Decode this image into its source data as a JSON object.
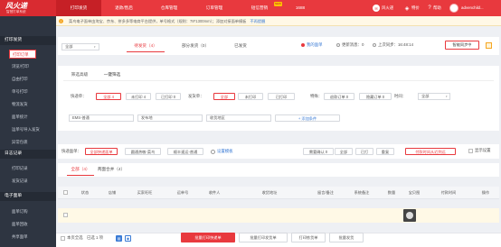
{
  "header": {
    "logo_main": "风火递",
    "logo_sub": "智慧打单系统",
    "nav": [
      "打印发货",
      "退款/售后",
      "仓库管理",
      "订单管理",
      "短信营销",
      "1688"
    ],
    "nav_badge": "NEW",
    "right": {
      "fenghuo": "风火递",
      "orders": "特价",
      "help": "帮助",
      "user": "advenchild..."
    }
  },
  "sidebar": {
    "groups": [
      {
        "title": "打印发货",
        "items": [
          "打印订单",
          "浏览/打印",
          "自由打印",
          "单号打印",
          "物流发货",
          "面单统计",
          "运单号导入发货",
          "异常包裹"
        ]
      },
      {
        "title": "日志记录",
        "items": [
          "打印记录",
          "发货记录"
        ]
      },
      {
        "title": "电子面单",
        "items": [
          "面单订购",
          "面单回收",
          "共享面单"
        ]
      }
    ]
  },
  "notice": {
    "text": "菜鸟电子面单由淘宝、京东、拼多多等电商平台提供，单号格式（规则：78*1300mm）；添加对接面单模板",
    "link": "不再提醒"
  },
  "toolbar": {
    "shop_select": "全部",
    "tabs": [
      "待发货（4）",
      "部分发货（0）",
      "已发货"
    ],
    "ad_link": "我的面单",
    "sync_label": "更新消息：0",
    "sync_time": "上次同步：16:48:14",
    "sync_btn": "智能同步中"
  },
  "filter": {
    "tabs": [
      "筛选高级",
      "一键筛选"
    ],
    "row1": {
      "flag_label": "快递单：",
      "flag_opts": [
        "全部 4",
        "未打印 4",
        "已打印 0"
      ],
      "ship_label": "发货单：",
      "ship_opts": [
        "全部",
        "未打印",
        "已打印"
      ],
      "other_label": "特殊：",
      "other_opts": [
        "退款订单 0",
        "隐藏订单 0"
      ],
      "time_label": "时间：",
      "time_value": "全部"
    },
    "row2": {
      "carrier": "EMS-普通",
      "province": "发布地",
      "address": "收货地区",
      "add": "+ 添加条件"
    }
  },
  "quick": {
    "label": "快递面单：",
    "opts": [
      "全部快递面单",
      "圆通热敏-菜鸟",
      "顺丰速运-普通"
    ],
    "settings": "设置模板",
    "right_opts": [
      "需要确认 0",
      "全部",
      "已打",
      "重复"
    ],
    "select": "付款时间从近到远",
    "show": "显示设置"
  },
  "list": {
    "tabs": [
      "全部（4）",
      "两面合并（4）"
    ],
    "headers": [
      "状态",
      "店铺",
      "买家旺旺",
      "运单号",
      "收件人",
      "收货地址",
      "留言/备注",
      "系统备注",
      "数量",
      "宝贝图",
      "付款时间",
      "操作"
    ]
  },
  "bottom": {
    "check_all": "本页全选",
    "selected": "已选 1 项",
    "print_express": "批量打印快递单",
    "print_invoice": "批量打印发货单",
    "print_picking": "打印拣货单",
    "batch_ship": "批量发货"
  },
  "colors": {
    "brand": "#e8393e",
    "sidebar": "#2e3541"
  }
}
